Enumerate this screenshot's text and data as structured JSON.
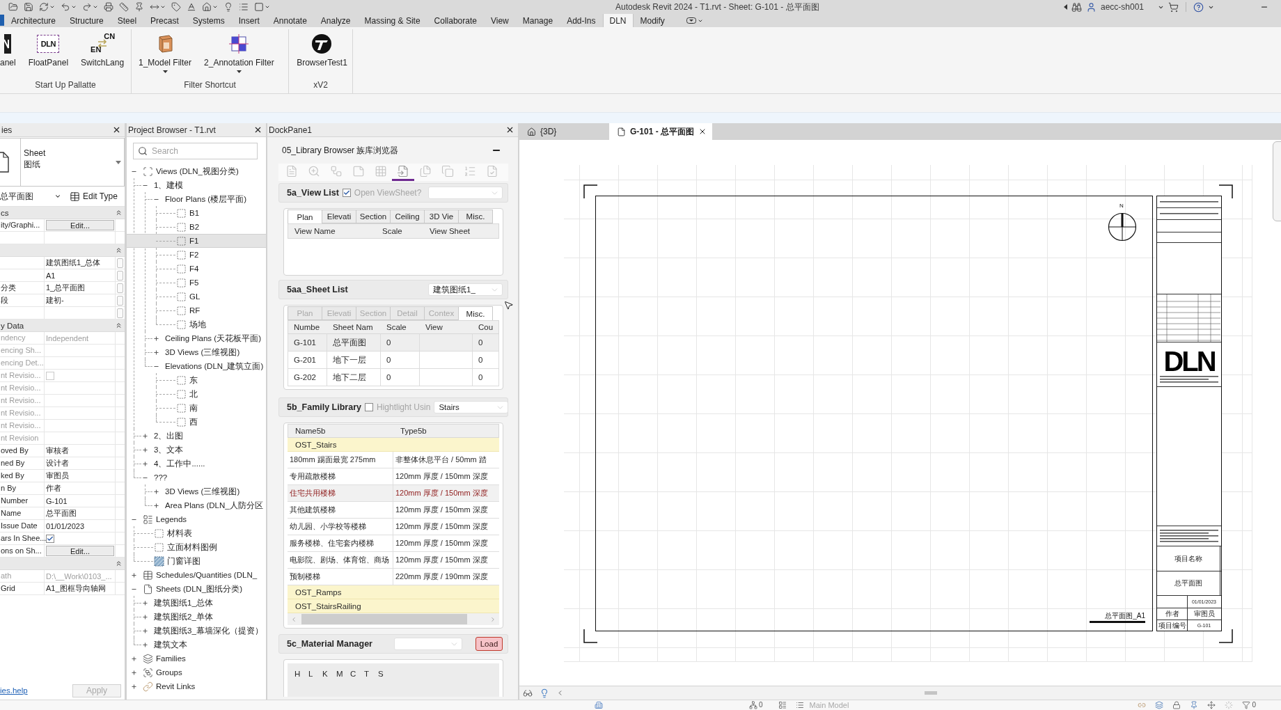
{
  "title_bar": {
    "title": "Autodesk Revit 2024 - T1.rvt - Sheet: G-101 - 总平面图",
    "user": "aecc-sh001"
  },
  "ribbon": {
    "tabs": [
      {
        "label": "Architecture",
        "selected": false
      },
      {
        "label": "Structure",
        "selected": false
      },
      {
        "label": "Steel",
        "selected": false
      },
      {
        "label": "Precast",
        "selected": false
      },
      {
        "label": "Systems",
        "selected": false
      },
      {
        "label": "Insert",
        "selected": false
      },
      {
        "label": "Annotate",
        "selected": false
      },
      {
        "label": "Analyze",
        "selected": false
      },
      {
        "label": "Massing & Site",
        "selected": false
      },
      {
        "label": "Collaborate",
        "selected": false
      },
      {
        "label": "View",
        "selected": false
      },
      {
        "label": "Manage",
        "selected": false
      },
      {
        "label": "Add-Ins",
        "selected": false
      },
      {
        "label": "DLN",
        "selected": true
      },
      {
        "label": "Modify",
        "selected": false
      }
    ],
    "groups": [
      {
        "label": "Start Up Pallatte",
        "buttons": [
          {
            "label": "anel",
            "kind": "panel",
            "dropdown": false
          },
          {
            "label": "FloatPanel",
            "kind": "float",
            "icon_labels": [
              "DLN"
            ],
            "dropdown": false
          },
          {
            "label": "SwitchLang",
            "kind": "lang",
            "icon_labels": [
              "CN",
              "EN"
            ],
            "dropdown": false
          }
        ]
      },
      {
        "label": "Filter Shortcut",
        "buttons": [
          {
            "label": "1_Model Filter",
            "kind": "model",
            "dropdown": true
          },
          {
            "label": "2_Annotation Filter",
            "kind": "annotation",
            "dropdown": true
          }
        ]
      },
      {
        "label": "xV2",
        "buttons": [
          {
            "label": "BrowserTest1",
            "kind": "browser",
            "dropdown": false
          }
        ]
      }
    ]
  },
  "properties": {
    "title": "ies",
    "type": {
      "line_1": "Sheet",
      "line_2": "图纸"
    },
    "instance": "总平面图",
    "edit_type": "Edit Type",
    "rows": [
      {
        "kind": "section",
        "label": "cs",
        "expanded": true
      },
      {
        "kind": "button",
        "label": "ity/Graphi...",
        "value": "Edit...",
        "disabled": false,
        "side_button": false
      },
      {
        "kind": "text",
        "side_button": false
      },
      {
        "kind": "section",
        "expanded": true
      },
      {
        "kind": "text",
        "value": "建筑图纸1_总体",
        "disabled": false,
        "side_button": true
      },
      {
        "kind": "text",
        "value": "A1",
        "disabled": false,
        "side_button": true
      },
      {
        "kind": "text",
        "label": "分类",
        "value": "1_总平面图",
        "disabled": false,
        "side_button": true
      },
      {
        "kind": "text",
        "label": "段",
        "value": "建初-",
        "disabled": false,
        "side_button": true
      },
      {
        "kind": "text",
        "side_button": true
      },
      {
        "kind": "section",
        "label": "y Data",
        "expanded": true
      },
      {
        "kind": "text",
        "label": "ndency",
        "value": "Independent",
        "disabled": true,
        "side_button": false
      },
      {
        "kind": "text",
        "label": "encing Sh...",
        "disabled": true,
        "side_button": false
      },
      {
        "kind": "text",
        "label": "encing Det...",
        "disabled": true,
        "side_button": false
      },
      {
        "kind": "check",
        "label": "nt Revisio...",
        "checked": false,
        "disabled": true,
        "side_button": false
      },
      {
        "kind": "text",
        "label": "nt Revisio...",
        "disabled": true,
        "side_button": false
      },
      {
        "kind": "text",
        "label": "nt Revisio...",
        "disabled": true,
        "side_button": false
      },
      {
        "kind": "text",
        "label": "nt Revisio...",
        "disabled": true,
        "side_button": false
      },
      {
        "kind": "text",
        "label": "nt Revisio...",
        "disabled": true,
        "side_button": false
      },
      {
        "kind": "text",
        "label": "nt Revision",
        "disabled": true,
        "side_button": false
      },
      {
        "kind": "text",
        "label": "oved By",
        "value": "审核者",
        "disabled": false,
        "side_button": false
      },
      {
        "kind": "text",
        "label": "ned By",
        "value": "设计者",
        "disabled": false,
        "side_button": false
      },
      {
        "kind": "text",
        "label": "ked By",
        "value": "审图员",
        "disabled": false,
        "side_button": false
      },
      {
        "kind": "text",
        "label": "n By",
        "value": "作者",
        "disabled": false,
        "side_button": false
      },
      {
        "kind": "text",
        "label": "Number",
        "value": "G-101",
        "disabled": false,
        "side_button": false
      },
      {
        "kind": "text",
        "label": "Name",
        "value": "总平面图",
        "disabled": false,
        "side_button": false
      },
      {
        "kind": "text",
        "label": "Issue Date",
        "value": "01/01/2023",
        "disabled": false,
        "side_button": false
      },
      {
        "kind": "check",
        "label": "ars In Shee...",
        "checked": true,
        "disabled": false,
        "side_button": false
      },
      {
        "kind": "button",
        "label": "ons on Sh...",
        "value": "Edit...",
        "disabled": false,
        "side_button": false
      },
      {
        "kind": "section",
        "expanded": true
      },
      {
        "kind": "text",
        "label": "ath",
        "value": "D:\\__Work\\0103_...",
        "disabled": true,
        "side_button": false
      },
      {
        "kind": "text",
        "label": "Grid",
        "value": "A1_图框导向轴网",
        "disabled": false,
        "side_button": false
      }
    ],
    "help_link": "ies.help",
    "apply": {
      "label": "Apply",
      "disabled": true
    }
  },
  "project_browser": {
    "title": "Project Browser - T1.rvt",
    "search": {
      "placeholder": "Search"
    },
    "tree": [
      {
        "label": "Views (DLN_视图分类)",
        "kind": "views",
        "expanded": true,
        "selected": false,
        "children": [
          {
            "label": "1、建模",
            "expanded": true,
            "selected": false,
            "children": [
              {
                "label": "Floor Plans (楼层平面)",
                "expanded": true,
                "selected": false,
                "children": [
                  {
                    "label": "B1",
                    "kind": "view",
                    "selected": false
                  },
                  {
                    "label": "B2",
                    "kind": "view",
                    "selected": false
                  },
                  {
                    "label": "F1",
                    "kind": "view",
                    "selected": true
                  },
                  {
                    "label": "F2",
                    "kind": "view",
                    "selected": false
                  },
                  {
                    "label": "F4",
                    "kind": "view",
                    "selected": false
                  },
                  {
                    "label": "F5",
                    "kind": "view",
                    "selected": false
                  },
                  {
                    "label": "GL",
                    "kind": "view",
                    "selected": false
                  },
                  {
                    "label": "RF",
                    "kind": "view",
                    "selected": false
                  },
                  {
                    "label": "场地",
                    "kind": "view",
                    "selected": false
                  }
                ]
              },
              {
                "label": "Ceiling Plans (天花板平面)",
                "expanded": false,
                "selected": false
              },
              {
                "label": "3D Views (三维视图)",
                "expanded": false,
                "selected": false
              },
              {
                "label": "Elevations (DLN_建筑立面)",
                "expanded": true,
                "selected": false,
                "children": [
                  {
                    "label": "东",
                    "kind": "view",
                    "selected": false
                  },
                  {
                    "label": "北",
                    "kind": "view",
                    "selected": false
                  },
                  {
                    "label": "南",
                    "kind": "view",
                    "selected": false
                  },
                  {
                    "label": "西",
                    "kind": "view",
                    "selected": false
                  }
                ]
              }
            ]
          },
          {
            "label": "2、出图",
            "expanded": false,
            "selected": false
          },
          {
            "label": "3、文本",
            "expanded": false,
            "selected": false
          },
          {
            "label": "4、工作中......",
            "expanded": false,
            "selected": false
          },
          {
            "label": "???",
            "expanded": true,
            "selected": false,
            "children": [
              {
                "label": "3D Views (三维视图)",
                "expanded": false,
                "selected": false
              },
              {
                "label": "Area Plans (DLN_人防分区",
                "expanded": false,
                "selected": false
              }
            ]
          }
        ]
      },
      {
        "label": "Legends",
        "kind": "legends",
        "expanded": true,
        "selected": false,
        "children": [
          {
            "label": "材料表",
            "kind": "view",
            "selected": false
          },
          {
            "label": "立面材料图例",
            "kind": "view",
            "selected": false
          },
          {
            "label": "门窗详图",
            "kind": "drafting",
            "selected": false
          }
        ]
      },
      {
        "label": "Schedules/Quantities (DLN_",
        "kind": "schedules",
        "expanded": false,
        "selected": false
      },
      {
        "label": "Sheets (DLN_图纸分类)",
        "kind": "sheets",
        "expanded": true,
        "selected": false,
        "children": [
          {
            "label": "建筑图纸1_总体",
            "expanded": false,
            "selected": false
          },
          {
            "label": "建筑图纸2_单体",
            "expanded": false,
            "selected": false
          },
          {
            "label": "建筑图纸3_幕墙深化（提资）",
            "expanded": false,
            "selected": false
          },
          {
            "label": "建筑文本",
            "expanded": false,
            "selected": false
          }
        ]
      },
      {
        "label": "Families",
        "kind": "families",
        "expanded": false,
        "selected": false
      },
      {
        "label": "Groups",
        "kind": "groups",
        "expanded": false,
        "selected": false
      },
      {
        "label": "Revit Links",
        "kind": "links",
        "expanded": false,
        "selected": false
      }
    ]
  },
  "dock_pane": {
    "title": "DockPane1",
    "browser_title": "05_Library Browser 族库浏览器",
    "tools": [
      {
        "selected": false
      },
      {
        "selected": false
      },
      {
        "selected": false
      },
      {
        "selected": false
      },
      {
        "selected": false
      },
      {
        "selected": true
      },
      {
        "selected": false
      },
      {
        "selected": false
      },
      {
        "selected": false
      },
      {
        "selected": false
      }
    ],
    "view_list": {
      "title": "5a_View List",
      "option": {
        "label": "Open ViewSheet?",
        "checked": true
      },
      "tabs": [
        {
          "label": "Plan",
          "selected": true,
          "disabled": false
        },
        {
          "label": "Elevati",
          "selected": false,
          "disabled": false
        },
        {
          "label": "Section",
          "selected": false,
          "disabled": false
        },
        {
          "label": "Ceiling",
          "selected": false,
          "disabled": false
        },
        {
          "label": "3D Vie",
          "selected": false,
          "disabled": false
        },
        {
          "label": "Misc.",
          "selected": false,
          "disabled": false
        }
      ],
      "columns": [
        "View Name",
        "Scale",
        "View Sheet"
      ]
    },
    "sheet_list": {
      "title": "5aa_Sheet List",
      "filter": "建筑图纸1_",
      "tabs": [
        {
          "label": "Plan",
          "selected": false,
          "disabled": true
        },
        {
          "label": "Elevati",
          "selected": false,
          "disabled": true
        },
        {
          "label": "Section",
          "selected": false,
          "disabled": true
        },
        {
          "label": "Detail",
          "selected": false,
          "disabled": true
        },
        {
          "label": "Contex",
          "selected": false,
          "disabled": true
        },
        {
          "label": "Misc.",
          "selected": true,
          "disabled": false
        }
      ],
      "columns": [
        "Numbe",
        "Sheet Nam",
        "Scale",
        "View",
        "Cou"
      ],
      "rows": [
        {
          "number": "G-101",
          "sheet_name": "总平面图",
          "scale": "0",
          "column_5": "0",
          "selected": true
        },
        {
          "number": "G-201",
          "sheet_name": "地下一层",
          "scale": "0",
          "column_5": "0",
          "selected": false
        },
        {
          "number": "G-202",
          "sheet_name": "地下二层",
          "scale": "0",
          "column_5": "0",
          "selected": false
        }
      ]
    },
    "family_library": {
      "title": "5b_Family Library",
      "option": {
        "label": "Hightlight Usin",
        "checked": false
      },
      "category": "Stairs",
      "columns": [
        "Name5b",
        "Type5b"
      ],
      "rows": [
        {
          "kind": "group",
          "label": "OST_Stairs"
        },
        {
          "kind": "item",
          "name": "180mm 踢面最宽 275mm",
          "type": "非整体休息平台 / 50mm 踏",
          "highlighted": false
        },
        {
          "kind": "item",
          "name": "专用疏散楼梯",
          "type": "120mm 厚度 / 150mm 深度",
          "highlighted": false
        },
        {
          "kind": "item",
          "name": "住宅共用楼梯",
          "type": "120mm 厚度 / 150mm 深度",
          "highlighted": true
        },
        {
          "kind": "item",
          "name": "其他建筑楼梯",
          "type": "120mm 厚度 / 150mm 深度",
          "highlighted": false
        },
        {
          "kind": "item",
          "name": "幼儿园、小学校等楼梯",
          "type": "120mm 厚度 / 150mm 深度",
          "highlighted": false
        },
        {
          "kind": "item",
          "name": "服务楼梯、住宅套内楼梯",
          "type": "120mm 厚度 / 150mm 深度",
          "highlighted": false
        },
        {
          "kind": "item",
          "name": "电影院、剧场、体育馆、商场",
          "type": "120mm 厚度 / 150mm 深度",
          "highlighted": false
        },
        {
          "kind": "item",
          "name": "预制楼梯",
          "type": "220mm 厚度 / 190mm 深度",
          "highlighted": false
        },
        {
          "kind": "group",
          "label": "OST_Ramps"
        },
        {
          "kind": "group",
          "label": "OST_StairsRailing"
        }
      ]
    },
    "material_manager": {
      "title": "5c_Material Manager",
      "load": "Load",
      "columns": [
        "H",
        "L",
        "K",
        "M",
        "C",
        "T",
        "S"
      ]
    }
  },
  "view": {
    "tabs": [
      {
        "label": "{3D}",
        "kind": "model",
        "selected": false
      },
      {
        "label": "G-101 - 总平面图",
        "kind": "sheet",
        "selected": true
      }
    ],
    "sheet": {
      "north": "N",
      "view_title": "总平面图_A1",
      "title_block": {
        "logo": "DLN",
        "project_name": "项目名称",
        "sheet_title": "总平面图",
        "date": "01/01/2023",
        "drawn_by": "作者",
        "checked_by": "审图员",
        "project_number": "项目编号",
        "sheet_number": "G-101"
      }
    }
  },
  "status_bar": {
    "editable_count": "0",
    "workset": {
      "label": "Main Model",
      "disabled": true
    },
    "filter_count": "0"
  }
}
